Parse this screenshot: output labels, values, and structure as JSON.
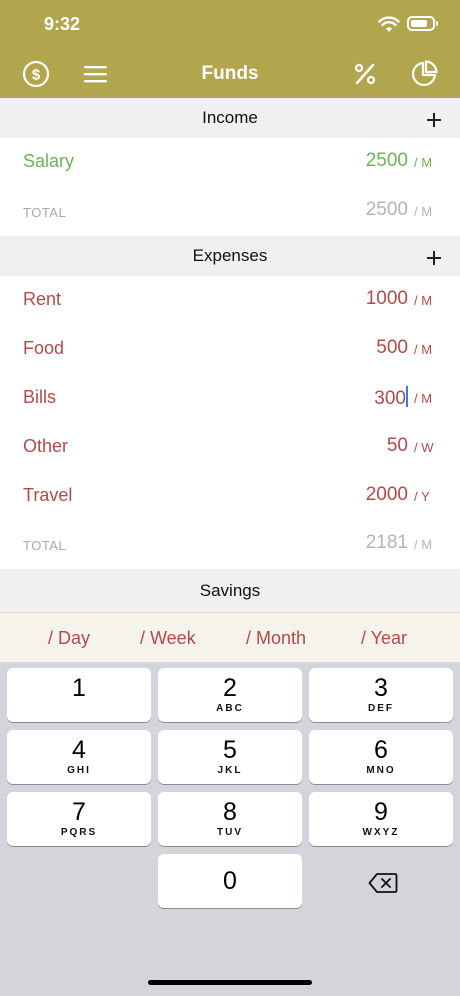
{
  "status_bar": {
    "time": "9:32"
  },
  "navbar": {
    "title": "Funds",
    "left_icons": [
      "dollar-circle-icon",
      "menu-icon"
    ],
    "right_icons": [
      "percent-icon",
      "pie-chart-icon"
    ],
    "color": "#b1a54d"
  },
  "income": {
    "title": "Income",
    "rows": [
      {
        "label": "Salary",
        "value": "2500",
        "per": "/ M"
      }
    ],
    "total": {
      "label": "TOTAL",
      "value": "2500",
      "per": "/ M"
    }
  },
  "expenses": {
    "title": "Expenses",
    "rows": [
      {
        "label": "Rent",
        "value": "1000",
        "per": "/ M"
      },
      {
        "label": "Food",
        "value": "500",
        "per": "/ M"
      },
      {
        "label": "Bills",
        "value": "300",
        "per": "/ M"
      },
      {
        "label": "Other",
        "value": "50",
        "per": "/ W"
      },
      {
        "label": "Travel",
        "value": "2000",
        "per": "/ Y"
      }
    ],
    "total": {
      "label": "TOTAL",
      "value": "2181",
      "per": "/ M"
    }
  },
  "savings": {
    "title": "Savings"
  },
  "period_options": [
    "/ Day",
    "/ Week",
    "/ Month",
    "/ Year"
  ],
  "keypad": {
    "keys": [
      {
        "digit": "1",
        "letters": ""
      },
      {
        "digit": "2",
        "letters": "ABC"
      },
      {
        "digit": "3",
        "letters": "DEF"
      },
      {
        "digit": "4",
        "letters": "GHI"
      },
      {
        "digit": "5",
        "letters": "JKL"
      },
      {
        "digit": "6",
        "letters": "MNO"
      },
      {
        "digit": "7",
        "letters": "PQRS"
      },
      {
        "digit": "8",
        "letters": "TUV"
      },
      {
        "digit": "9",
        "letters": "WXYZ"
      },
      {
        "digit": "0",
        "letters": ""
      }
    ]
  },
  "colors": {
    "income": "#6fb258",
    "expense": "#b04b4b",
    "muted": "#b5b5b5"
  }
}
